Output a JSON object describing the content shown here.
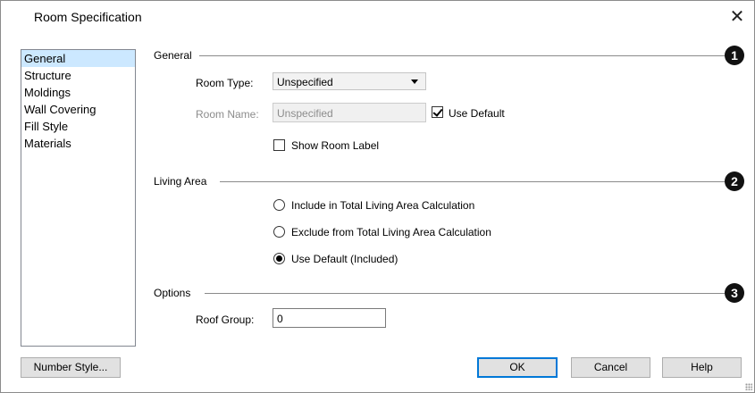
{
  "window": {
    "title": "Room Specification",
    "close_glyph": "✕"
  },
  "nav": {
    "items": [
      {
        "label": "General",
        "selected": true
      },
      {
        "label": "Structure"
      },
      {
        "label": "Moldings"
      },
      {
        "label": "Wall Covering"
      },
      {
        "label": "Fill Style"
      },
      {
        "label": "Materials"
      }
    ]
  },
  "sections": {
    "general": {
      "label": "General",
      "badge": "1"
    },
    "living": {
      "label": "Living Area",
      "badge": "2"
    },
    "options": {
      "label": "Options",
      "badge": "3"
    }
  },
  "general": {
    "room_type_label": "Room Type:",
    "room_type_value": "Unspecified",
    "room_name_label": "Room Name:",
    "room_name_value": "Unspecified",
    "use_default_label": "Use Default",
    "use_default_checked": true,
    "show_label_label": "Show Room Label",
    "show_label_checked": false
  },
  "living": {
    "options": [
      {
        "label": "Include in Total Living Area Calculation",
        "selected": false
      },
      {
        "label": "Exclude from Total Living Area Calculation",
        "selected": false
      },
      {
        "label": "Use Default (Included)",
        "selected": true
      }
    ]
  },
  "options": {
    "roof_group_label": "Roof Group:",
    "roof_group_value": "0"
  },
  "buttons": {
    "number_style": "Number Style...",
    "ok": "OK",
    "cancel": "Cancel",
    "help": "Help"
  },
  "colors": {
    "accent": "#0078d7",
    "selection": "#cce8ff"
  }
}
